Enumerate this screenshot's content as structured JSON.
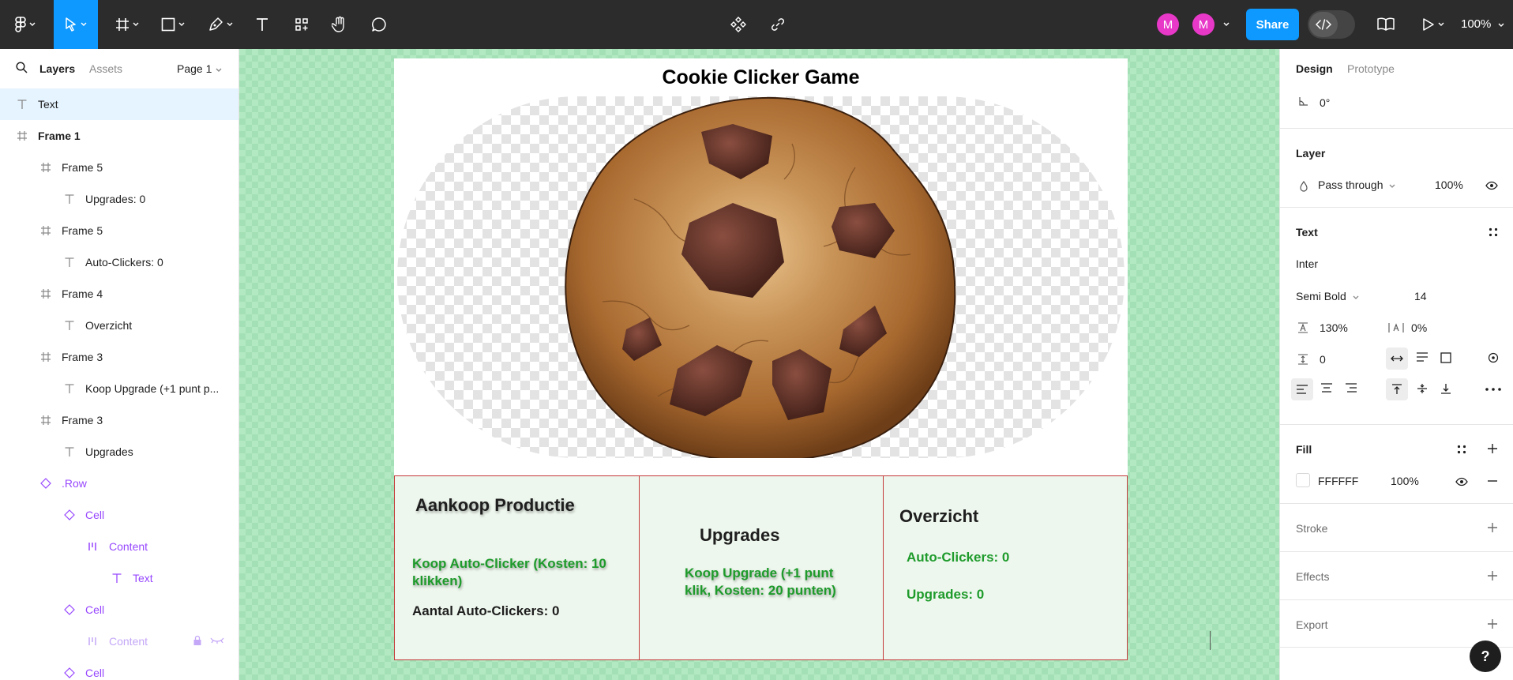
{
  "toolbar": {
    "share_label": "Share",
    "zoom": "100%",
    "avatar1": "M",
    "avatar2": "M",
    "accent": "#0d99ff"
  },
  "layers_panel": {
    "tabs": [
      "Layers",
      "Assets"
    ],
    "page": "Page 1",
    "items": [
      {
        "label": "Text",
        "icon": "text-icon",
        "indent": 0,
        "selected": true,
        "kind": "text"
      },
      {
        "label": "Frame 1",
        "icon": "frame-icon",
        "indent": 0,
        "bold": true,
        "kind": "frame"
      },
      {
        "label": "Frame 5",
        "icon": "frame-icon",
        "indent": 1,
        "kind": "frame"
      },
      {
        "label": "Upgrades: 0",
        "icon": "text-icon",
        "indent": 2,
        "kind": "text"
      },
      {
        "label": "Frame 5",
        "icon": "frame-icon",
        "indent": 1,
        "kind": "frame"
      },
      {
        "label": "Auto-Clickers: 0",
        "icon": "text-icon",
        "indent": 2,
        "kind": "text"
      },
      {
        "label": "Frame 4",
        "icon": "frame-icon",
        "indent": 1,
        "kind": "frame"
      },
      {
        "label": "Overzicht",
        "icon": "text-icon",
        "indent": 2,
        "kind": "text"
      },
      {
        "label": "Frame 3",
        "icon": "frame-icon",
        "indent": 1,
        "kind": "frame"
      },
      {
        "label": "Koop Upgrade (+1 punt p...",
        "icon": "text-icon",
        "indent": 2,
        "kind": "text"
      },
      {
        "label": "Frame 3",
        "icon": "frame-icon",
        "indent": 1,
        "kind": "frame"
      },
      {
        "label": "Upgrades",
        "icon": "text-icon",
        "indent": 2,
        "kind": "text"
      },
      {
        "label": ".Row",
        "icon": "component-icon",
        "indent": 1,
        "kind": "comp"
      },
      {
        "label": "Cell",
        "icon": "component-icon",
        "indent": 2,
        "kind": "comp"
      },
      {
        "label": "Content",
        "icon": "autolayout-icon",
        "indent": 3,
        "kind": "comp"
      },
      {
        "label": "Text",
        "icon": "text-icon",
        "indent": 4,
        "kind": "comp"
      },
      {
        "label": "Cell",
        "icon": "component-icon",
        "indent": 2,
        "kind": "comp"
      },
      {
        "label": "Content",
        "icon": "autolayout-icon",
        "indent": 3,
        "kind": "dim"
      },
      {
        "label": "Cell",
        "icon": "component-icon",
        "indent": 2,
        "kind": "comp"
      }
    ]
  },
  "canvas": {
    "title": "Cookie Clicker Game",
    "cells": [
      {
        "heading": "Aankoop Productie",
        "action": "Koop Auto-Clicker (Kosten: 10 klikken)",
        "info": "Aantal Auto-Clickers: 0"
      },
      {
        "heading": "Upgrades",
        "action": "Koop Upgrade (+1 punt klik, Kosten: 20 punten)"
      },
      {
        "heading": "Overzicht",
        "stat1": "Auto-Clickers: 0",
        "stat2": "Upgrades: 0"
      }
    ],
    "colors": {
      "canvas_bg": "#b3e9c2",
      "cell_bg": "#eef7ee",
      "cell_border": "#c33a3a",
      "green_text": "#1e9b2b"
    }
  },
  "design_panel": {
    "tabs": [
      "Design",
      "Prototype"
    ],
    "rotation": "0°",
    "layer": {
      "title": "Layer",
      "blend": "Pass through",
      "opacity": "100%"
    },
    "text": {
      "title": "Text",
      "font": "Inter",
      "weight": "Semi Bold",
      "size": "14",
      "line_height": "130%",
      "letter_spacing": "0%",
      "paragraph_spacing": "0"
    },
    "fill": {
      "title": "Fill",
      "hex": "FFFFFF",
      "opacity": "100%"
    },
    "stroke_title": "Stroke",
    "effects_title": "Effects",
    "export_title": "Export"
  },
  "help_label": "?"
}
